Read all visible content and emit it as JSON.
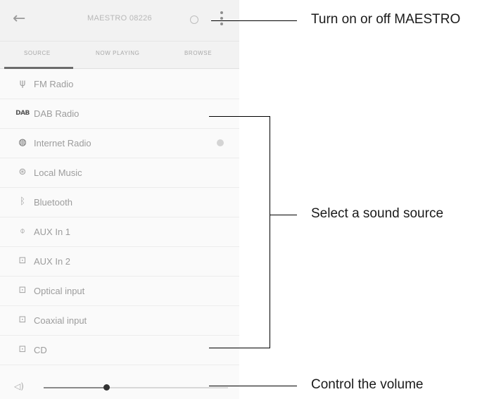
{
  "screen": {
    "device_name": "MAESTRO 08226",
    "back_icon": "arrow-left-icon",
    "power_icon": "power-circle-icon",
    "menu_icon": "vertical-dots-icon"
  },
  "tabs": [
    {
      "label": "Source",
      "active": true
    },
    {
      "label": "Now playing",
      "active": false
    },
    {
      "label": "Browse",
      "active": false
    }
  ],
  "sources": [
    {
      "label": "FM Radio",
      "icon": "antenna-icon"
    },
    {
      "label": "DAB Radio",
      "icon": "dab-icon"
    },
    {
      "label": "Internet Radio",
      "icon": "globe-icon"
    },
    {
      "label": "Local Music",
      "icon": "disc-icon"
    },
    {
      "label": "Bluetooth",
      "icon": "bluetooth-icon"
    },
    {
      "label": "AUX In 1",
      "icon": "jack-icon"
    },
    {
      "label": "AUX In 2",
      "icon": "aux-port-icon"
    },
    {
      "label": "Optical input",
      "icon": "optical-port-icon"
    },
    {
      "label": "Coaxial input",
      "icon": "coaxial-port-icon"
    },
    {
      "label": "CD",
      "icon": "cd-port-icon"
    }
  ],
  "volume": {
    "icon": "speaker-icon",
    "level": 0.34
  },
  "callouts": {
    "power": "Turn on or off MAESTRO",
    "source": "Select a sound source",
    "volume": "Control the volume"
  }
}
